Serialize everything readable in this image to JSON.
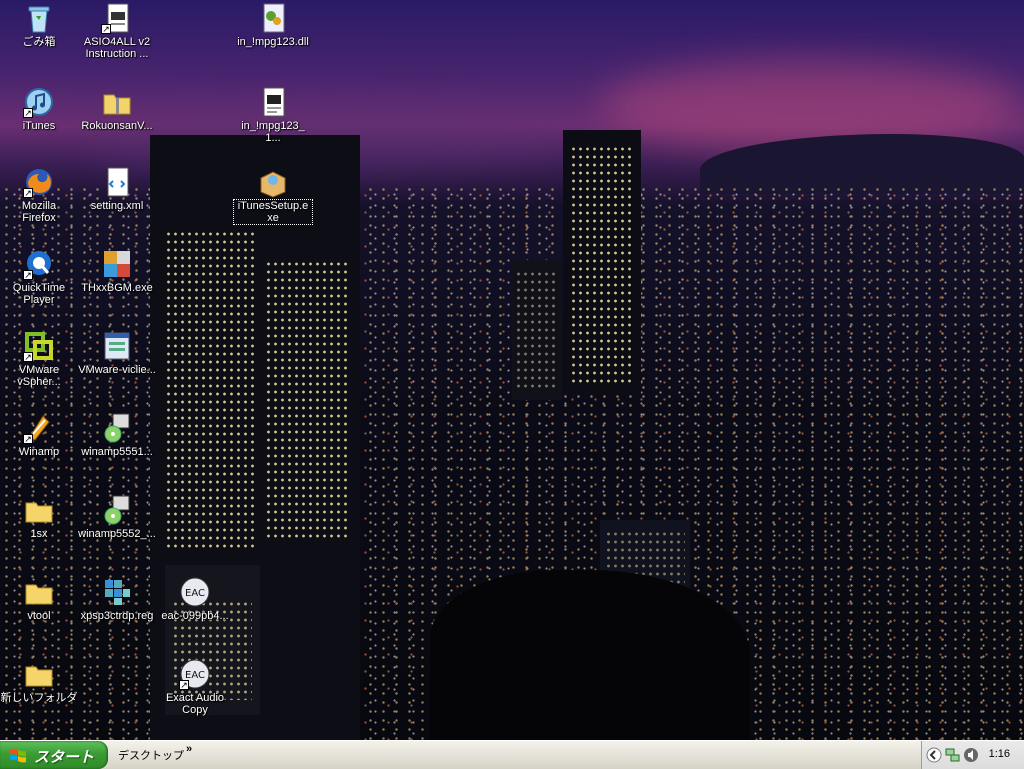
{
  "desktop": {
    "icons": [
      {
        "label": "ごみ箱",
        "icon": "recycle-bin-icon",
        "shortcut": false
      },
      {
        "label": "ASIO4ALL v2\nInstruction ...",
        "icon": "document-shortcut-icon",
        "shortcut": true
      },
      {
        "label": "in_!mpg123.dll",
        "icon": "dll-file-icon",
        "shortcut": false
      },
      {
        "label": "iTunes",
        "icon": "itunes-icon",
        "shortcut": true
      },
      {
        "label": "RokuonsanV...",
        "icon": "zip-folder-icon",
        "shortcut": false
      },
      {
        "label": "in_!mpg123_1...",
        "icon": "text-file-icon",
        "shortcut": false
      },
      {
        "label": "Mozilla\nFirefox",
        "icon": "firefox-icon",
        "shortcut": true
      },
      {
        "label": "setting.xml",
        "icon": "xml-file-icon",
        "shortcut": false
      },
      {
        "label": "iTunesSetup.e\nxe",
        "icon": "installer-icon",
        "shortcut": false,
        "selected": true
      },
      {
        "label": "QuickTime\nPlayer",
        "icon": "quicktime-icon",
        "shortcut": true
      },
      {
        "label": "THxxBGM.exe",
        "icon": "mfc-app-icon",
        "shortcut": false
      },
      {
        "label": "VMware\nvSpher...",
        "icon": "vmware-icon",
        "shortcut": true
      },
      {
        "label": "VMware-viclie...",
        "icon": "setup-exe-icon",
        "shortcut": false
      },
      {
        "label": "Winamp",
        "icon": "winamp-icon",
        "shortcut": true
      },
      {
        "label": "winamp5551...",
        "icon": "winamp-installer-icon",
        "shortcut": false
      },
      {
        "label": "1sx",
        "icon": "folder-icon",
        "shortcut": false
      },
      {
        "label": "winamp5552_...",
        "icon": "winamp-installer-icon",
        "shortcut": false
      },
      {
        "label": "vtool",
        "icon": "folder-icon",
        "shortcut": false
      },
      {
        "label": "xpsp3ctrdp.reg",
        "icon": "registry-file-icon",
        "shortcut": false
      },
      {
        "label": "eac-099pb4...",
        "icon": "eac-icon",
        "shortcut": false
      },
      {
        "label": "新しいフォルダ",
        "icon": "folder-icon",
        "shortcut": false
      },
      {
        "label": "Exact Audio\nCopy",
        "icon": "eac-icon",
        "shortcut": true
      }
    ]
  },
  "taskbar": {
    "start_label": "スタート",
    "quick_launch_label": "デスクトップ",
    "chevron": "»",
    "clock": "1:16"
  }
}
